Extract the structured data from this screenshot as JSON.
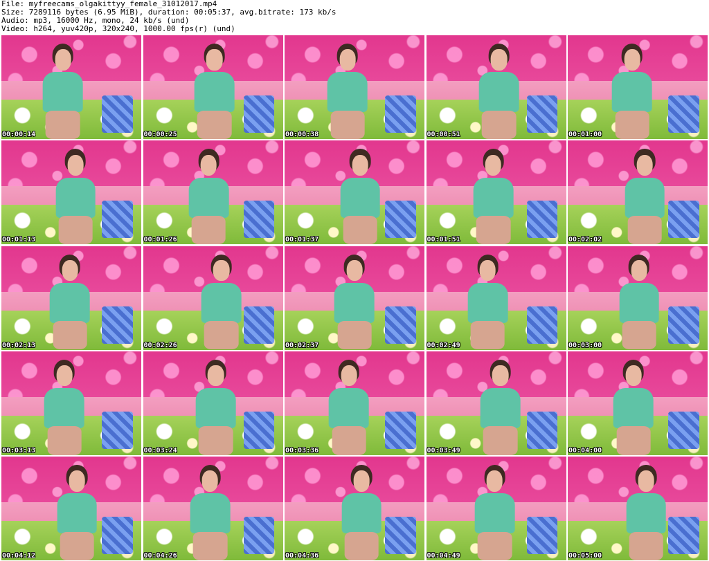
{
  "info": {
    "file": "File: myfreecams_olgakittyy_female_31012017.mp4",
    "size": "Size: 7289116 bytes (6.95 MiB), duration: 00:05:37, avg.bitrate: 173 kb/s",
    "audio": "Audio: mp3, 16000 Hz, mono, 24 kb/s (und)",
    "video": "Video: h264, yuv420p, 320x240, 1000.00 fps(r) (und)"
  },
  "thumbnails": [
    {
      "timestamp": "00:00:14"
    },
    {
      "timestamp": "00:00:25"
    },
    {
      "timestamp": "00:00:38"
    },
    {
      "timestamp": "00:00:51"
    },
    {
      "timestamp": "00:01:00"
    },
    {
      "timestamp": "00:01:13"
    },
    {
      "timestamp": "00:01:26"
    },
    {
      "timestamp": "00:01:37"
    },
    {
      "timestamp": "00:01:51"
    },
    {
      "timestamp": "00:02:02"
    },
    {
      "timestamp": "00:02:13"
    },
    {
      "timestamp": "00:02:26"
    },
    {
      "timestamp": "00:02:37"
    },
    {
      "timestamp": "00:02:49"
    },
    {
      "timestamp": "00:03:00"
    },
    {
      "timestamp": "00:03:13"
    },
    {
      "timestamp": "00:03:24"
    },
    {
      "timestamp": "00:03:36"
    },
    {
      "timestamp": "00:03:49"
    },
    {
      "timestamp": "00:04:00"
    },
    {
      "timestamp": "00:04:12"
    },
    {
      "timestamp": "00:04:26"
    },
    {
      "timestamp": "00:04:36"
    },
    {
      "timestamp": "00:04:49"
    },
    {
      "timestamp": "00:05:00"
    }
  ]
}
